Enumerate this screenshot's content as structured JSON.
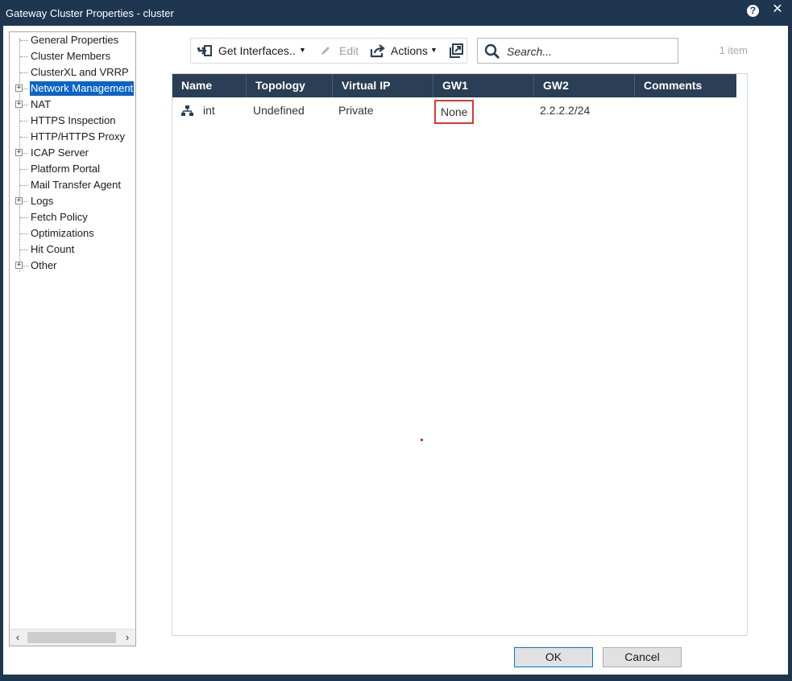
{
  "window": {
    "title": "Gateway Cluster Properties - cluster",
    "help_icon": "?",
    "close_icon": "✕"
  },
  "tree": {
    "items": [
      {
        "label": "General Properties",
        "expandable": false,
        "selected": false
      },
      {
        "label": "Cluster Members",
        "expandable": false,
        "selected": false
      },
      {
        "label": "ClusterXL and VRRP",
        "expandable": false,
        "selected": false
      },
      {
        "label": "Network Management",
        "expandable": true,
        "selected": true
      },
      {
        "label": "NAT",
        "expandable": true,
        "selected": false
      },
      {
        "label": "HTTPS Inspection",
        "expandable": false,
        "selected": false
      },
      {
        "label": "HTTP/HTTPS Proxy",
        "expandable": false,
        "selected": false
      },
      {
        "label": "ICAP Server",
        "expandable": true,
        "selected": false
      },
      {
        "label": "Platform Portal",
        "expandable": false,
        "selected": false
      },
      {
        "label": "Mail Transfer Agent",
        "expandable": false,
        "selected": false
      },
      {
        "label": "Logs",
        "expandable": true,
        "selected": false
      },
      {
        "label": "Fetch Policy",
        "expandable": false,
        "selected": false
      },
      {
        "label": "Optimizations",
        "expandable": false,
        "selected": false
      },
      {
        "label": "Hit Count",
        "expandable": false,
        "selected": false
      },
      {
        "label": "Other",
        "expandable": true,
        "selected": false
      }
    ]
  },
  "toolbar": {
    "get_interfaces_label": "Get Interfaces..",
    "edit_label": "Edit",
    "actions_label": "Actions"
  },
  "search": {
    "placeholder": "Search..."
  },
  "item_count": "1 item",
  "table": {
    "columns": [
      "Name",
      "Topology",
      "Virtual IP",
      "GW1",
      "GW2",
      "Comments"
    ],
    "rows": [
      {
        "name": "int",
        "topology": "Undefined",
        "virtual_ip": "Private",
        "gw1": "None",
        "gw2": "2.2.2.2/24",
        "comments": ""
      }
    ]
  },
  "buttons": {
    "ok_label": "OK",
    "cancel_label": "Cancel"
  },
  "colors": {
    "title_bar": "#1f3650",
    "table_header": "#2a3e55",
    "selection": "#0a64c8",
    "highlight_border": "#d93a32"
  }
}
